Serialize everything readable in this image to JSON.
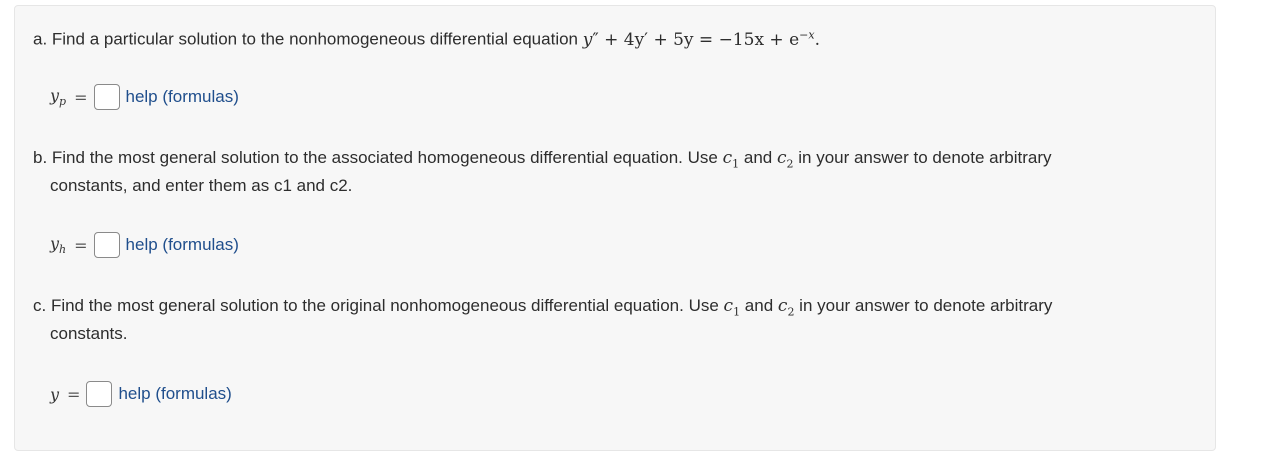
{
  "part_a": {
    "prefix": "a. Find a particular solution to the nonhomogeneous differential equation",
    "eq_y": "y",
    "eq_main": "″ + 4y′ + 5y = −15x + e",
    "eq_exp": "−x",
    "eq_end": ".",
    "answer_var": "y",
    "answer_sub": "p",
    "equals": "=",
    "answer_value": "",
    "help_label": "help (formulas)"
  },
  "part_b": {
    "line1_prefix": "b. Find the most general solution to the associated homogeneous differential equation. Use",
    "c1": "c",
    "c1_sub": "1",
    "and": "and",
    "c2": "c",
    "c2_sub": "2",
    "line1_suffix": "in your answer to denote arbitrary",
    "line2": "constants, and enter them as c1 and c2.",
    "answer_var": "y",
    "answer_sub": "h",
    "equals": "=",
    "answer_value": "",
    "help_label": "help (formulas)"
  },
  "part_c": {
    "line1_prefix": "c. Find the most general solution to the original nonhomogeneous differential equation. Use",
    "c1": "c",
    "c1_sub": "1",
    "and": "and",
    "c2": "c",
    "c2_sub": "2",
    "line1_suffix": "in your answer to denote arbitrary",
    "line2": "constants.",
    "answer_var": "y",
    "equals": "=",
    "answer_value": "",
    "help_label": "help (formulas)"
  },
  "colors": {
    "link": "#1f4e8c",
    "panel_bg": "#f7f7f7"
  }
}
